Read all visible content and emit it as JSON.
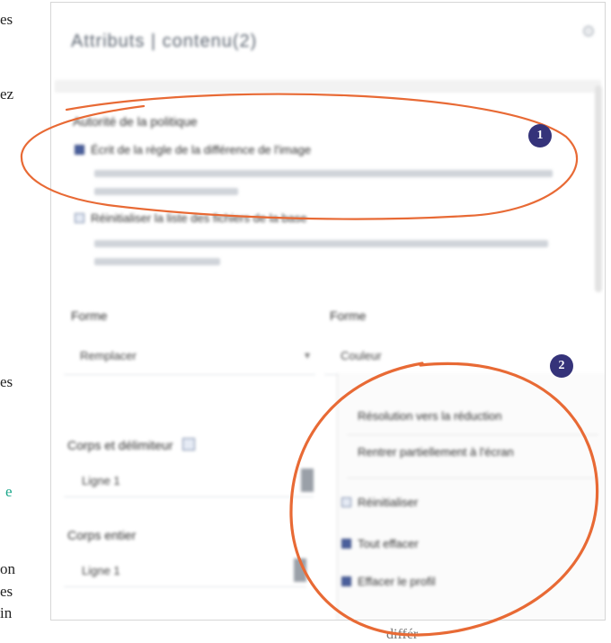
{
  "page_edge_text": [
    "es",
    "ez",
    "es",
    "e",
    "on",
    "es",
    "in"
  ],
  "page_bottom_text": "différ",
  "dialog": {
    "title": "Attributs | contenu(2)",
    "gear_icon": "⚙",
    "section_title": "Autorité de la politique",
    "option1": "Écrit de la règle de la différence de l'image",
    "option2": "Réinitialiser la liste des fichiers de la base"
  },
  "fields": {
    "left_label": "Forme",
    "left_value": "Remplacer",
    "right_label": "Forme",
    "right_value": "Couleur",
    "group1_label": "Corps et délimiteur",
    "group1_value": "Ligne 1",
    "group2_label": "Corps entier",
    "group2_value": "Ligne 1"
  },
  "menu": {
    "item1": "Résolution vers la réduction",
    "item2": "Rentrer partiellement à l'écran",
    "item3": "Réinitialiser",
    "item4": "Tout effacer",
    "item5": "Effacer le profil"
  },
  "annotations": {
    "badge1": "1",
    "badge2": "2",
    "accent_color": "#e86a35",
    "badge_color": "#35337a"
  }
}
